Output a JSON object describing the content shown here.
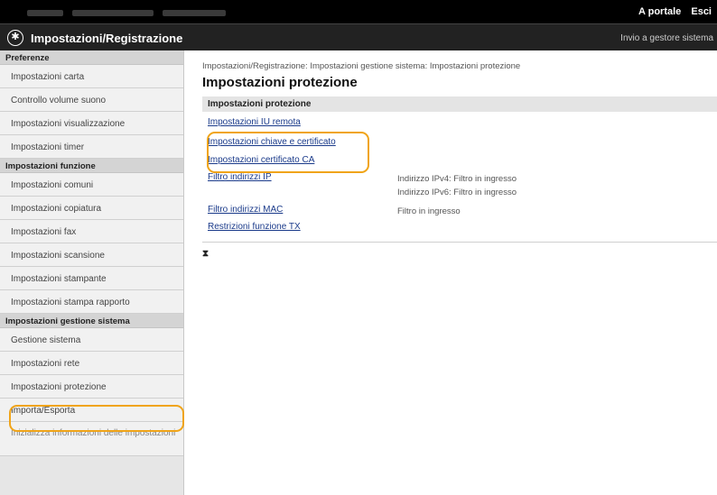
{
  "topbar": {
    "links": [
      "A portale",
      "Esci"
    ]
  },
  "header": {
    "title": "Impostazioni/Registrazione",
    "home_link": "Invio a gestore sistema"
  },
  "sidebar": {
    "groups": [
      {
        "heading": "Preferenze",
        "items": [
          "Impostazioni carta",
          "Controllo volume suono",
          "Impostazioni visualizzazione",
          "Impostazioni timer"
        ]
      },
      {
        "heading": "Impostazioni funzione",
        "items": [
          "Impostazioni comuni",
          "Impostazioni copiatura",
          "Impostazioni fax",
          "Impostazioni scansione",
          "Impostazioni stampante",
          "Impostazioni stampa rapporto"
        ]
      },
      {
        "heading": "Impostazioni gestione sistema",
        "items": [
          "Gestione sistema",
          "Impostazioni rete",
          "Impostazioni protezione",
          "Importa/Esporta",
          "Inizializza informazioni delle impostazioni"
        ]
      }
    ],
    "selected": "Impostazioni protezione"
  },
  "main": {
    "breadcrumb": "Impostazioni/Registrazione: Impostazioni gestione sistema: Impostazioni protezione",
    "title": "Impostazioni protezione",
    "section_header": "Impostazioni protezione",
    "links": [
      "Impostazioni IU remota",
      "Impostazioni chiave e certificato",
      "Impostazioni certificato CA",
      "Filtro indirizzi IP",
      "Filtro indirizzi MAC",
      "Restrizioni funzione TX"
    ],
    "values": {
      "ip_line1": "Indirizzo IPv4: Filtro in ingresso",
      "ip_line2": "Indirizzo IPv6: Filtro in ingresso",
      "mac": "Filtro in ingresso"
    },
    "to_top_symbol": "⧗"
  },
  "colors": {
    "highlight": "#f0a418",
    "link": "#1a3a8a",
    "header_bg": "#222222"
  }
}
